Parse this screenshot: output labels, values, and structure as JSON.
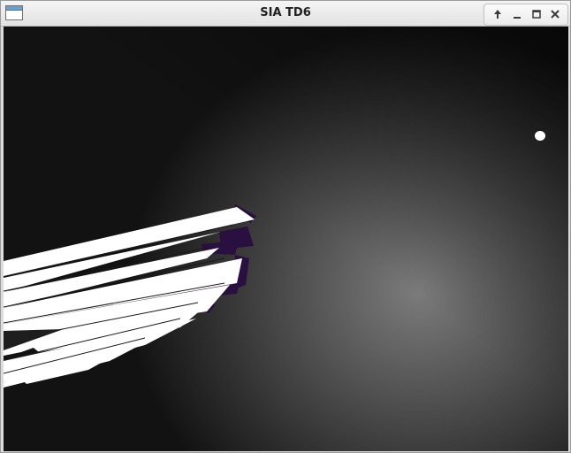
{
  "window": {
    "title": "SIA TD6",
    "controls": [
      "up-arrow-icon",
      "minimize-icon",
      "maximize-icon",
      "close-icon"
    ]
  },
  "scene": {
    "light_color": "#ffffff",
    "mesh_color": "#ffffff",
    "shadow_color": "#2a1040"
  }
}
